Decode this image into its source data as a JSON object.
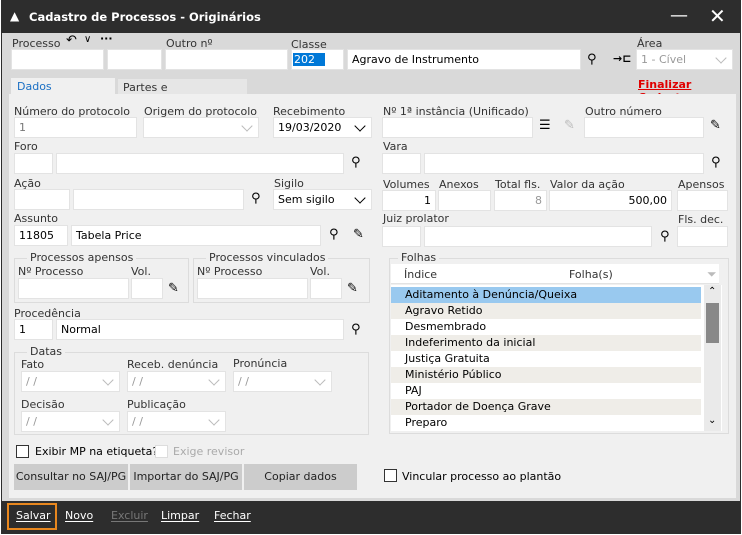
{
  "window": {
    "title": "Cadastro de Processos - Originários"
  },
  "header": {
    "processo_label": "Processo",
    "outro_label": "Outro nº",
    "classe_label": "Classe",
    "classe_code": "202",
    "classe_name": "Agravo de Instrumento",
    "area_label": "Área",
    "area_value": "1 - Cível",
    "finalizar": "Finalizar Cadastro"
  },
  "tabs": [
    {
      "label": "Dados Processuais",
      "active": true
    },
    {
      "label": "Partes e Representantes",
      "active": false
    }
  ],
  "form": {
    "num_protocolo_label": "Número do protocolo",
    "num_protocolo_value": "1",
    "origem_label": "Origem do protocolo",
    "recebimento_label": "Recebimento",
    "recebimento_value": "19/03/2020",
    "instancia_label": "Nº 1ª instância (Unificado)",
    "outro_numero_label": "Outro número",
    "foro_label": "Foro",
    "vara_label": "Vara",
    "acao_label": "Ação",
    "sigilo_label": "Sigilo",
    "sigilo_value": "Sem sigilo",
    "volumes_label": "Volumes",
    "volumes_value": "1",
    "anexos_label": "Anexos",
    "total_label": "Total fls.",
    "total_value": "8",
    "valor_label": "Valor da ação",
    "valor_value": "500,00",
    "apensos_label": "Apensos",
    "assunto_label": "Assunto",
    "assunto_code": "11805",
    "assunto_name": "Tabela Price",
    "juiz_label": "Juiz prolator",
    "fls_dec_label": "Fls. dec.",
    "apensos_group": "Processos apensos",
    "vinculados_group": "Processos vinculados",
    "nproc_label": "Nº Processo",
    "vol_label": "Vol.",
    "procedencia_label": "Procedência",
    "procedencia_code": "1",
    "procedencia_name": "Normal",
    "datas_group": "Datas",
    "fato_label": "Fato",
    "receb_den_label": "Receb. denúncia",
    "pronuncia_label": "Pronúncia",
    "decisao_label": "Decisão",
    "publicacao_label": "Publicação",
    "empty_date": " /  /",
    "exibir_mp": "Exibir MP na etiqueta?",
    "exige_revisor": "Exige revisor",
    "vincular": "Vincular processo ao plantão"
  },
  "folhas": {
    "group": "Folhas",
    "col_indice": "Índice",
    "col_folhas": "Folha(s)",
    "selected_index": 0,
    "items": [
      "Aditamento à Denúncia/Queixa",
      "Agravo Retido",
      "Desmembrado",
      "Indeferimento da inicial",
      "Justiça Gratuita",
      "Ministério Público",
      "PAJ",
      "Portador de Doença Grave",
      "Preparo"
    ]
  },
  "buttons": {
    "consultar": "Consultar no SAJ/PG",
    "importar": "Importar do SAJ/PG",
    "copiar": "Copiar dados"
  },
  "footer": {
    "salvar": "Salvar",
    "novo": "Novo",
    "excluir": "Excluir",
    "limpar": "Limpar",
    "fechar": "Fechar"
  },
  "colors": {
    "titlebar": "#2d2d2d",
    "selection": "#0078d7",
    "row_selected": "#99c9ef",
    "finalizar": "#e00000",
    "focus_outline": "#e8871e"
  }
}
